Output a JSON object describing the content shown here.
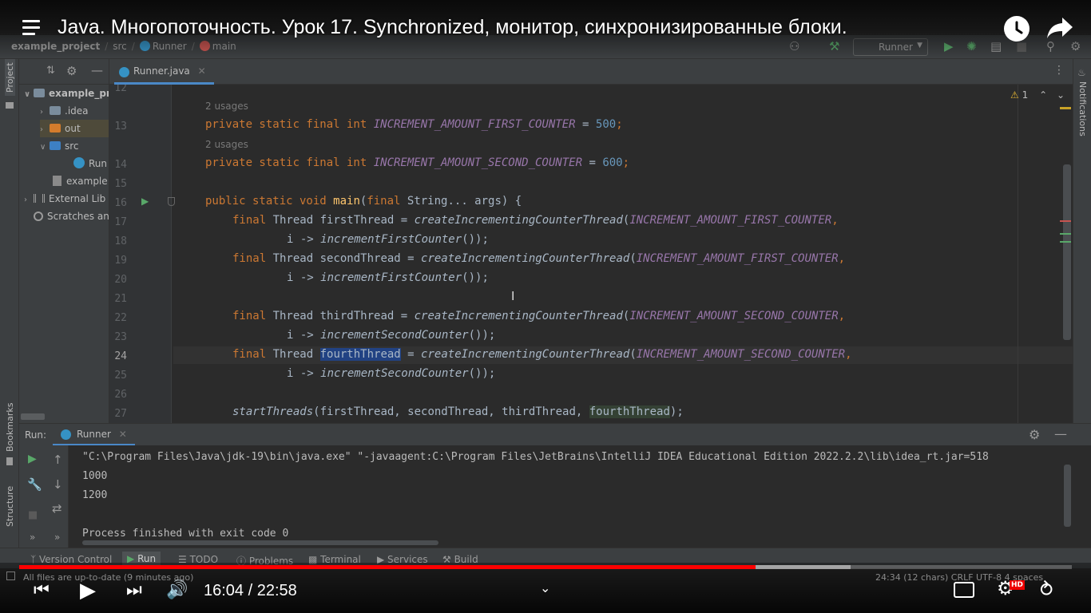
{
  "video": {
    "title": "Java. Многопоточность. Урок 17. Synchronized, монитор, синхронизированные блоки.",
    "current_time": "16:04",
    "duration": "22:58",
    "time_display": "16:04 / 22:58",
    "progress_fraction": 0.6996,
    "buffered_fraction": 0.79,
    "hd_badge": "HD"
  },
  "ide": {
    "breadcrumb": [
      "example_project",
      "src",
      "Runner",
      "main"
    ],
    "run_config": "Runner",
    "left_strip": {
      "project": "Project",
      "bookmarks": "Bookmarks",
      "structure": "Structure"
    },
    "right_strip": {
      "notifications": "Notifications"
    },
    "project_tree": [
      {
        "label": "example_pr",
        "icon": "module-folder-icon"
      },
      {
        "label": ".idea",
        "icon": "folder-icon"
      },
      {
        "label": "out",
        "icon": "folder-orange-icon"
      },
      {
        "label": "src",
        "icon": "folder-blue-icon"
      },
      {
        "label": "Run",
        "icon": "java-class-icon"
      },
      {
        "label": "example",
        "icon": "iml-file-icon"
      },
      {
        "label": "External Lib",
        "icon": "library-icon"
      },
      {
        "label": "Scratches an",
        "icon": "scratches-icon"
      }
    ],
    "editor_tab": "Runner.java",
    "warnings": "1",
    "line_numbers": [
      "12",
      "13",
      "14",
      "15",
      "16",
      "17",
      "18",
      "19",
      "20",
      "21",
      "22",
      "23",
      "24",
      "25",
      "26",
      "27"
    ],
    "usages": [
      "2 usages",
      "2 usages"
    ],
    "code": {
      "l13_kw": "private static final int ",
      "l13_const": "INCREMENT_AMOUNT_FIRST_COUNTER",
      "l13_eq": " = ",
      "l13_val": "500",
      "l13_end": ";",
      "l14_kw": "private static final int ",
      "l14_const": "INCREMENT_AMOUNT_SECOND_COUNTER",
      "l14_eq": " = ",
      "l14_val": "600",
      "l14_end": ";",
      "l16_kw": "public static void ",
      "l16_fn": "main",
      "l16_p1": "(",
      "l16_final": "final ",
      "l16_rest": "String... args) {",
      "l17_kw": "final ",
      "l17_a": "Thread firstThread = ",
      "l17_fn": "createIncrementingCounterThread",
      "l17_p": "(",
      "l17_const": "INCREMENT_AMOUNT_FIRST_COUNTER",
      "l17_end": ",",
      "l18_a": "i -> ",
      "l18_fn": "incrementFirstCounter",
      "l18_end": "());",
      "l19_kw": "final ",
      "l19_a": "Thread secondThread = ",
      "l19_fn": "createIncrementingCounterThread",
      "l19_p": "(",
      "l19_const": "INCREMENT_AMOUNT_FIRST_COUNTER",
      "l19_end": ",",
      "l20_a": "i -> ",
      "l20_fn": "incrementFirstCounter",
      "l20_end": "());",
      "l22_kw": "final ",
      "l22_a": "Thread thirdThread = ",
      "l22_fn": "createIncrementingCounterThread",
      "l22_p": "(",
      "l22_const": "INCREMENT_AMOUNT_SECOND_COUNTER",
      "l22_end": ",",
      "l23_a": "i -> ",
      "l23_fn": "incrementSecondCounter",
      "l23_end": "());",
      "l24_kw": "final ",
      "l24_a": "Thread ",
      "l24_sel": "fourthThread",
      "l24_b": " = ",
      "l24_fn": "createIncrementingCounterThread",
      "l24_p": "(",
      "l24_const": "INCREMENT_AMOUNT_SECOND_COUNTER",
      "l24_end": ",",
      "l25_a": "i -> ",
      "l25_fn": "incrementSecondCounter",
      "l25_end": "());",
      "l27_fn": "startThreads",
      "l27_a": "(firstThread, secondThread, thirdThread, ",
      "l27_hl": "fourthThread",
      "l27_end": ");"
    },
    "run_panel": {
      "label": "Run:",
      "tab": "Runner",
      "console": [
        "\"C:\\Program Files\\Java\\jdk-19\\bin\\java.exe\" \"-javaagent:C:\\Program Files\\JetBrains\\IntelliJ IDEA Educational Edition 2022.2.2\\lib\\idea_rt.jar=518",
        "1000",
        "1200",
        "",
        "Process finished with exit code 0"
      ]
    },
    "bottom_tools": [
      "Version Control",
      "Run",
      "TODO",
      "Problems",
      "Terminal",
      "Services",
      "Build"
    ],
    "status": "All files are up-to-date (9 minutes ago)",
    "status_right": "24:34 (12 chars)   CRLF   UTF-8   4 spaces"
  },
  "colors": {
    "accent": "#4a88c7",
    "progress": "#ff0000",
    "keyword": "#cc7832",
    "constant": "#9876aa",
    "function": "#ffc66d",
    "number": "#6897bb"
  }
}
